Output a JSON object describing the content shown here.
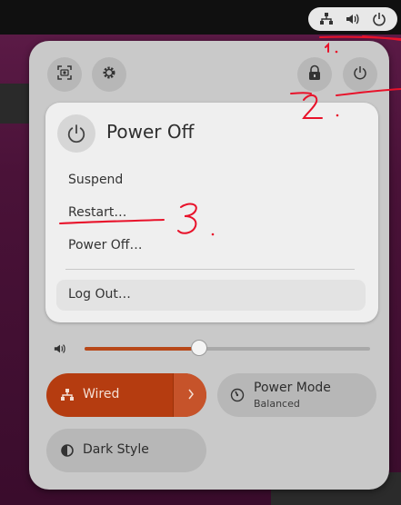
{
  "top_bar": {
    "tray_icons": [
      "network-wired-icon",
      "volume-icon",
      "power-icon"
    ]
  },
  "quick_settings": {
    "buttons": [
      "screenshot-icon",
      "settings-gear-icon",
      "lock-icon",
      "power-icon"
    ],
    "power_menu": {
      "title": "Power Off",
      "items": [
        "Suspend",
        "Restart…",
        "Power Off…"
      ],
      "logout": "Log Out…"
    },
    "volume": {
      "level": 0.4
    },
    "toggles": {
      "wired": {
        "label": "Wired",
        "active": true
      },
      "power_mode": {
        "label": "Power Mode",
        "subtitle": "Balanced"
      },
      "dark_style": {
        "label": "Dark Style"
      }
    }
  },
  "annotations": {
    "mark_1": "1",
    "mark_2": "2",
    "mark_3": "3"
  },
  "colors": {
    "accent": "#b53c10",
    "annotation": "#e8122a"
  }
}
